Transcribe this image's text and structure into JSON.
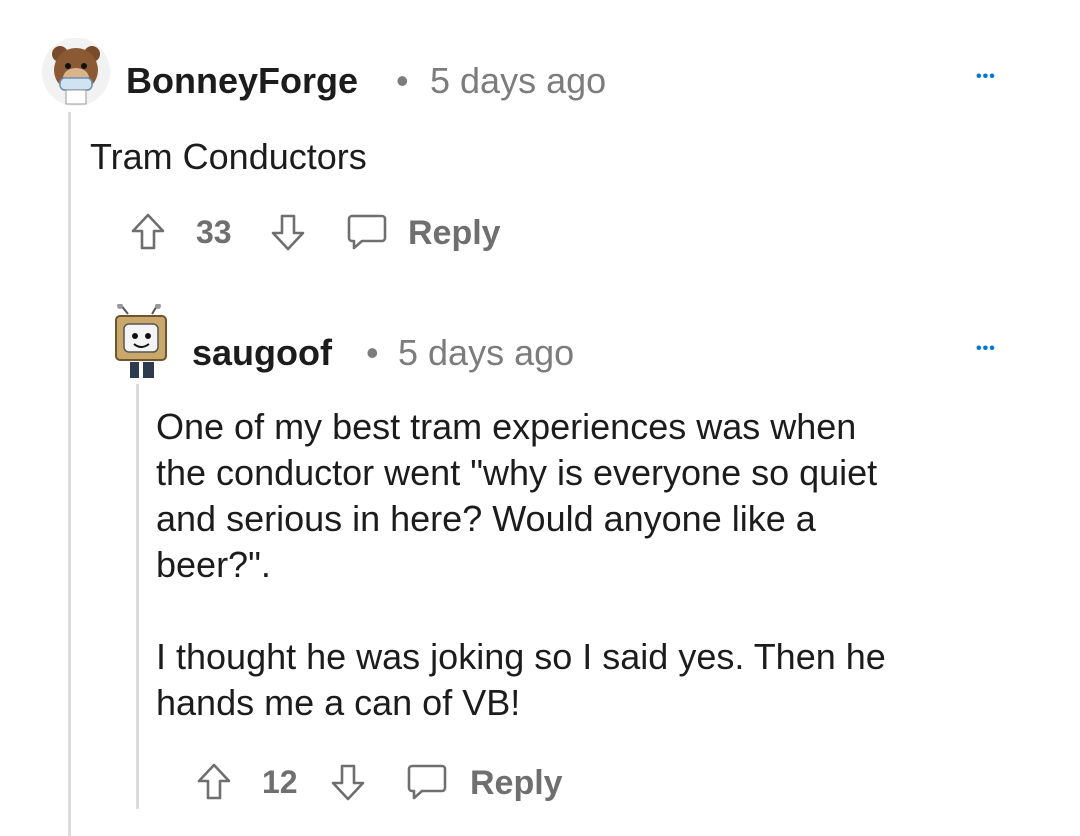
{
  "comments": [
    {
      "username": "BonneyForge",
      "separator": "•",
      "time": "5 days ago",
      "more": "•••",
      "body": [
        "Tram Conductors"
      ],
      "score": "33",
      "reply_label": "Reply",
      "avatar_icon": "bear-avatar-icon"
    },
    {
      "username": "saugoof",
      "separator": "•",
      "time": "5 days ago",
      "more": "•••",
      "body": [
        "One of my best tram experiences was when",
        "the conductor went \"why is everyone so quiet",
        "and serious in here? Would anyone like a",
        "beer?\".",
        "",
        "I thought he was joking so I said yes. Then he",
        "hands me a can of VB!"
      ],
      "score": "12",
      "reply_label": "Reply",
      "avatar_icon": "robot-avatar-icon"
    }
  ],
  "colors": {
    "accent": "#0079d3",
    "meta": "#7c7c7c",
    "thread_line": "#dcdcdc"
  }
}
